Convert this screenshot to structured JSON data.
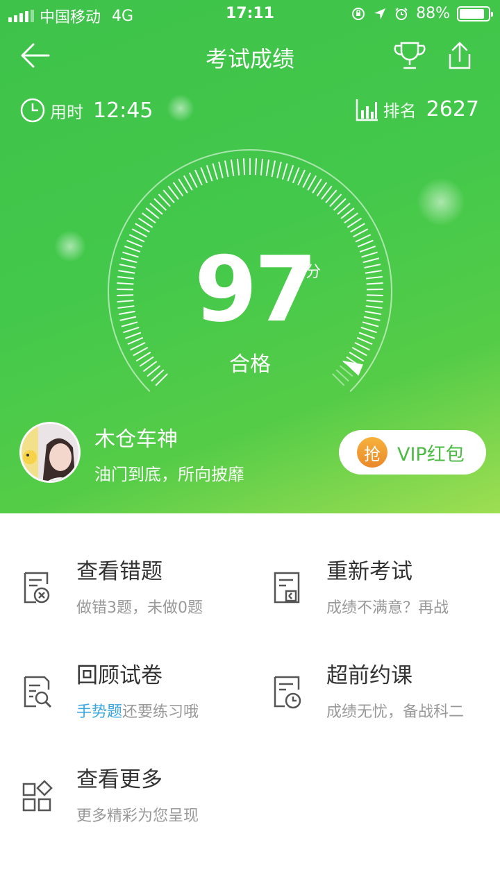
{
  "status_bar": {
    "carrier": "中国移动",
    "network": "4G",
    "time": "17:11",
    "battery": "88%",
    "battery_level": 0.88
  },
  "nav": {
    "title": "考试成绩"
  },
  "stats": {
    "time_label": "用时",
    "time_value": "12:45",
    "rank_label": "排名",
    "rank_value": "2627"
  },
  "result": {
    "score": "97",
    "unit": "分",
    "grade": "合格",
    "score_fraction": 0.97
  },
  "user": {
    "name": "木仓车神",
    "motto": "油门到底，所向披靡"
  },
  "vip": {
    "grab": "抢",
    "label": "VIP红包"
  },
  "menu": {
    "wrong": {
      "title": "查看错题",
      "subtitle": "做错3题，未做0题"
    },
    "retake": {
      "title": "重新考试",
      "subtitle": "成绩不满意？再战"
    },
    "review": {
      "title": "回顾试卷",
      "subtitle_highlight": "手势题",
      "subtitle_rest": "还要练习哦"
    },
    "book": {
      "title": "超前约课",
      "subtitle": "成绩无忧，备战科二"
    },
    "more": {
      "title": "查看更多",
      "subtitle": "更多精彩为您呈现"
    }
  },
  "colors": {
    "hero_green": "#43c84b",
    "highlight_blue": "#3aa7e0",
    "vip_green": "#4cbb43",
    "grab_orange": "#f0a030"
  },
  "icons": {
    "back": "arrow-left-icon",
    "trophy": "trophy-icon",
    "share": "share-icon",
    "clock": "clock-icon",
    "rank": "bar-chart-icon"
  }
}
